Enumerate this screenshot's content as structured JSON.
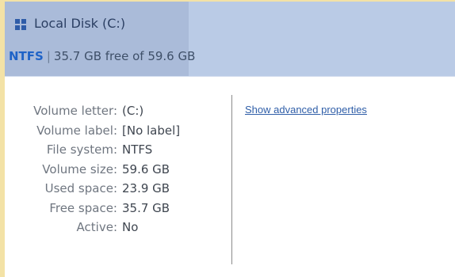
{
  "disk": {
    "icon": "windows-drive-icon",
    "title": "Local Disk (C:)",
    "filesystem": "NTFS",
    "separator": "|",
    "capacity_text": "35.7 GB free of 59.6 GB"
  },
  "properties": [
    {
      "label": "Volume letter:",
      "value": "(C:)"
    },
    {
      "label": "Volume label:",
      "value": "[No label]"
    },
    {
      "label": "File system:",
      "value": "NTFS"
    },
    {
      "label": "Volume size:",
      "value": "59.6 GB"
    },
    {
      "label": "Used space:",
      "value": "23.9 GB"
    },
    {
      "label": "Free space:",
      "value": "35.7 GB"
    },
    {
      "label": "Active:",
      "value": "No"
    }
  ],
  "link": {
    "advanced_label": "Show advanced properties"
  },
  "colors": {
    "header_bg": "#bacbe6",
    "header_tab_bg": "#aabbd9",
    "accent": "#1f63c7",
    "frame": "#f3e2a6"
  }
}
